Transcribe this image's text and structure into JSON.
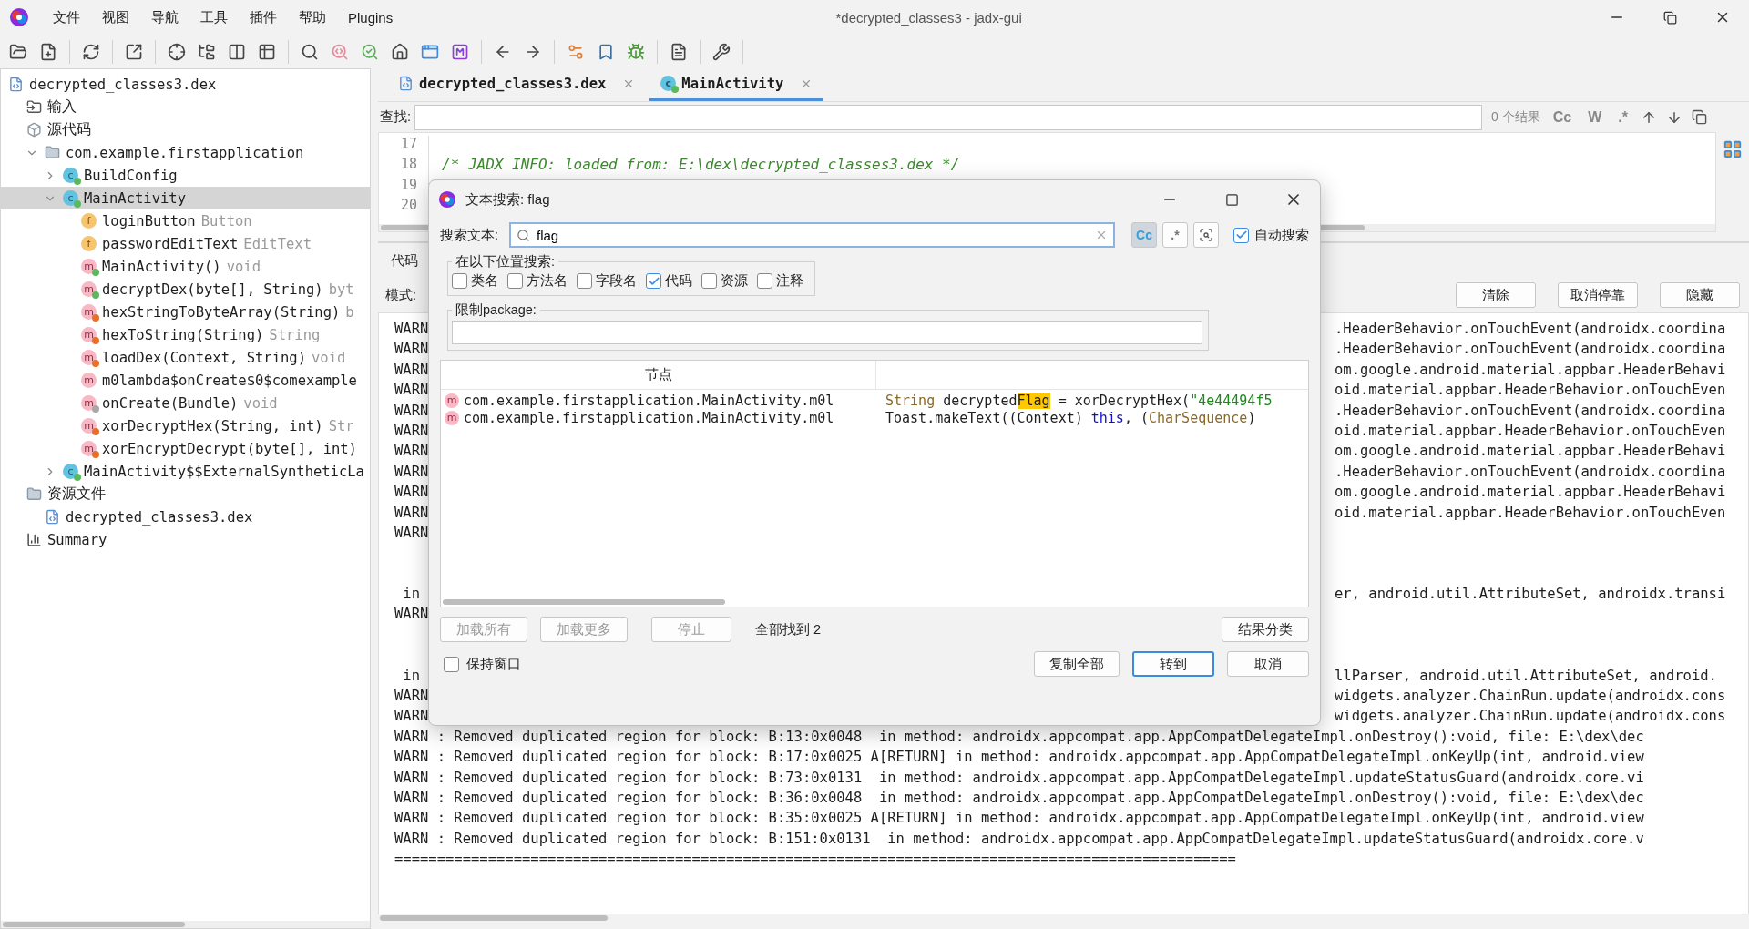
{
  "window": {
    "title": "*decrypted_classes3 - jadx-gui"
  },
  "menu": [
    "文件",
    "视图",
    "导航",
    "工具",
    "插件",
    "帮助",
    "Plugins"
  ],
  "tree": [
    {
      "kind": "dex",
      "label": "decrypted_classes3.dex",
      "selected": false,
      "children": [
        {
          "kind": "input",
          "label": "输入",
          "selected": false
        },
        {
          "kind": "source",
          "label": "源代码",
          "selected": false,
          "children": [
            {
              "kind": "package",
              "label": "com.example.firstapplication",
              "expanded": true,
              "selected": false,
              "children": [
                {
                  "kind": "class",
                  "letter": "c",
                  "color": "#5cb85c",
                  "label": "BuildConfig",
                  "expanded": false,
                  "selected": false
                },
                {
                  "kind": "class",
                  "letter": "c",
                  "color": "#5cb85c",
                  "label": "MainActivity",
                  "expanded": true,
                  "selected": true,
                  "children": [
                    {
                      "kind": "field",
                      "letter": "f",
                      "label": "loginButton",
                      "detail": "Button",
                      "selected": false
                    },
                    {
                      "kind": "field",
                      "letter": "f",
                      "label": "passwordEditText",
                      "detail": "EditText",
                      "selected": false
                    },
                    {
                      "kind": "method",
                      "letter": "m",
                      "color": "#5cb85c",
                      "label": "MainActivity()",
                      "detail": "void",
                      "selected": false
                    },
                    {
                      "kind": "method",
                      "letter": "m",
                      "color": "#5cb85c",
                      "label": "decryptDex(byte[], String)",
                      "detail": "byt",
                      "selected": false
                    },
                    {
                      "kind": "method",
                      "letter": "m",
                      "color": "#e8702a",
                      "label": "hexStringToByteArray(String)",
                      "detail": "b",
                      "selected": false
                    },
                    {
                      "kind": "method",
                      "letter": "m",
                      "color": "#e8702a",
                      "label": "hexToString(String)",
                      "detail": "String",
                      "selected": false
                    },
                    {
                      "kind": "method",
                      "letter": "m",
                      "color": "#e8702a",
                      "label": "loadDex(Context, String)",
                      "detail": "void",
                      "selected": false
                    },
                    {
                      "kind": "method",
                      "letter": "m",
                      "label": "m0lambda$onCreate$0$comexample",
                      "selected": false
                    },
                    {
                      "kind": "method",
                      "letter": "m",
                      "color": "#a8a8a8",
                      "label": "onCreate(Bundle)",
                      "detail": "void",
                      "selected": false
                    },
                    {
                      "kind": "method",
                      "letter": "m",
                      "color": "#e8702a",
                      "label": "xorDecryptHex(String, int)",
                      "detail": "Str",
                      "selected": false
                    },
                    {
                      "kind": "method",
                      "letter": "m",
                      "color": "#e8702a",
                      "label": "xorEncryptDecrypt(byte[], int)",
                      "selected": false
                    }
                  ]
                },
                {
                  "kind": "class",
                  "letter": "c",
                  "color": "#5cb85c",
                  "label": "MainActivity$$ExternalSyntheticLa",
                  "expanded": false,
                  "selected": false
                }
              ]
            }
          ]
        },
        {
          "kind": "resources",
          "label": "资源文件",
          "selected": false,
          "children": [
            {
              "kind": "dex",
              "label": "decrypted_classes3.dex",
              "selected": false
            }
          ]
        },
        {
          "kind": "summary",
          "label": "Summary",
          "selected": false
        }
      ]
    }
  ],
  "editor_tabs": [
    {
      "kind": "dex",
      "label": "decrypted_classes3.dex",
      "selected": false
    },
    {
      "kind": "class",
      "letter": "c",
      "color": "#5cb85c",
      "label": "MainActivity",
      "selected": true
    }
  ],
  "find_bar": {
    "label": "查找:",
    "result": "0 个结果",
    "toggles": [
      "Cc",
      "W",
      ".*"
    ]
  },
  "code": {
    "lines": [
      {
        "number": "17"
      },
      {
        "number": "18",
        "text": "/* JADX INFO: loaded from: E:\\dex\\decrypted_classes3.dex */"
      },
      {
        "number": "19"
      },
      {
        "number": "20"
      }
    ]
  },
  "log_panel": {
    "tab": "代码",
    "mode_label": "模式:",
    "buttons": [
      "清除",
      "取消停靠",
      "隐藏"
    ],
    "lines": [
      {
        "kind": "split",
        "left": "WARN",
        "right": ".HeaderBehavior.onTouchEvent(androidx.coordina"
      },
      {
        "kind": "split",
        "left": "WARN",
        "right": ".HeaderBehavior.onTouchEvent(androidx.coordina"
      },
      {
        "kind": "split",
        "left": "WARN",
        "right": "om.google.android.material.appbar.HeaderBehavi"
      },
      {
        "kind": "split",
        "left": "WARN",
        "right": "oid.material.appbar.HeaderBehavior.onTouchEven"
      },
      {
        "kind": "split",
        "left": "WARN",
        "right": ".HeaderBehavior.onTouchEvent(androidx.coordina"
      },
      {
        "kind": "split",
        "left": "WARN",
        "right": "oid.material.appbar.HeaderBehavior.onTouchEven"
      },
      {
        "kind": "split",
        "left": "WARN",
        "right": "om.google.android.material.appbar.HeaderBehavi"
      },
      {
        "kind": "split",
        "left": "WARN",
        "right": ".HeaderBehavior.onTouchEvent(androidx.coordina"
      },
      {
        "kind": "split",
        "left": "WARN",
        "right": "om.google.android.material.appbar.HeaderBehavi"
      },
      {
        "kind": "split",
        "left": "WARN",
        "right": "oid.material.appbar.HeaderBehavior.onTouchEven"
      },
      {
        "kind": "split",
        "left": "WARN"
      },
      {
        "kind": "blank"
      },
      {
        "kind": "blank"
      },
      {
        "kind": "split",
        "left": " in",
        "right": "er, android.util.AttributeSet, androidx.transi"
      },
      {
        "kind": "split",
        "left": "WARN"
      },
      {
        "kind": "blank"
      },
      {
        "kind": "blank"
      },
      {
        "kind": "split",
        "left": " in",
        "right": "llParser, android.util.AttributeSet, android."
      },
      {
        "kind": "split",
        "left": "WARN",
        "right": "widgets.analyzer.ChainRun.update(androidx.cons"
      },
      {
        "kind": "split",
        "left": "WARN",
        "right": "widgets.analyzer.ChainRun.update(androidx.cons"
      },
      {
        "kind": "full",
        "text": "WARN : Removed duplicated region for block: B:13:0x0048  in method: androidx.appcompat.app.AppCompatDelegateImpl.onDestroy():void, file: E:\\dex\\dec"
      },
      {
        "kind": "full",
        "text": "WARN : Removed duplicated region for block: B:17:0x0025 A[RETURN] in method: androidx.appcompat.app.AppCompatDelegateImpl.onKeyUp(int, android.view"
      },
      {
        "kind": "full",
        "text": "WARN : Removed duplicated region for block: B:73:0x0131  in method: androidx.appcompat.app.AppCompatDelegateImpl.updateStatusGuard(androidx.core.vi"
      },
      {
        "kind": "full",
        "text": "WARN : Removed duplicated region for block: B:36:0x0048  in method: androidx.appcompat.app.AppCompatDelegateImpl.onDestroy():void, file: E:\\dex\\dec"
      },
      {
        "kind": "full",
        "text": "WARN : Removed duplicated region for block: B:35:0x0025 A[RETURN] in method: androidx.appcompat.app.AppCompatDelegateImpl.onKeyUp(int, android.view"
      },
      {
        "kind": "full",
        "text": "WARN : Removed duplicated region for block: B:151:0x0131  in method: androidx.appcompat.app.AppCompatDelegateImpl.updateStatusGuard(androidx.core.v"
      },
      {
        "kind": "full",
        "text": "==================================================================================================="
      }
    ]
  },
  "dialog": {
    "title": "文本搜索: flag",
    "search_label": "搜索文本:",
    "search_value": "flag",
    "toggles": [
      {
        "label": "Cc",
        "selected": true
      },
      {
        "label": ".*",
        "selected": false
      }
    ],
    "auto_search": {
      "label": "自动搜索",
      "checked": true
    },
    "scope": {
      "title": "在以下位置搜索:",
      "options": [
        {
          "label": "类名",
          "checked": false
        },
        {
          "label": "方法名",
          "checked": false
        },
        {
          "label": "字段名",
          "checked": false
        },
        {
          "label": "代码",
          "checked": true
        },
        {
          "label": "资源",
          "checked": false
        },
        {
          "label": "注释",
          "checked": false
        }
      ]
    },
    "package": {
      "title": "限制package:"
    },
    "results": {
      "columns": [
        "节点"
      ],
      "rows": [
        {
          "letter": "m",
          "node": "com.example.firstapplication.MainActivity.m0l",
          "code": [
            {
              "kind": "type",
              "text": "String"
            },
            {
              "kind": "plain",
              "text": " decrypted"
            },
            {
              "kind": "match",
              "text": "Flag"
            },
            {
              "kind": "plain",
              "text": " = xorDecryptHex("
            },
            {
              "kind": "string",
              "text": "\"4e44494f5"
            }
          ]
        },
        {
          "letter": "m",
          "node": "com.example.firstapplication.MainActivity.m0l",
          "code": [
            {
              "kind": "plain",
              "text": "Toast.makeText((Context) "
            },
            {
              "kind": "keyword",
              "text": "this"
            },
            {
              "kind": "plain",
              "text": ", ("
            },
            {
              "kind": "type",
              "text": "CharSequence"
            },
            {
              "kind": "plain",
              "text": ")"
            }
          ]
        }
      ]
    },
    "action_buttons": [
      {
        "label": "加载所有",
        "disabled": true
      },
      {
        "label": "加载更多",
        "disabled": true
      },
      {
        "label": "停止",
        "disabled": true
      }
    ],
    "found": "全部找到 2",
    "group_button": "结果分类",
    "keep_window": {
      "label": "保持窗口",
      "checked": false
    },
    "footer_buttons": [
      {
        "label": "复制全部",
        "default": false
      },
      {
        "label": "转到",
        "default": true
      },
      {
        "label": "取消",
        "default": false
      }
    ]
  }
}
